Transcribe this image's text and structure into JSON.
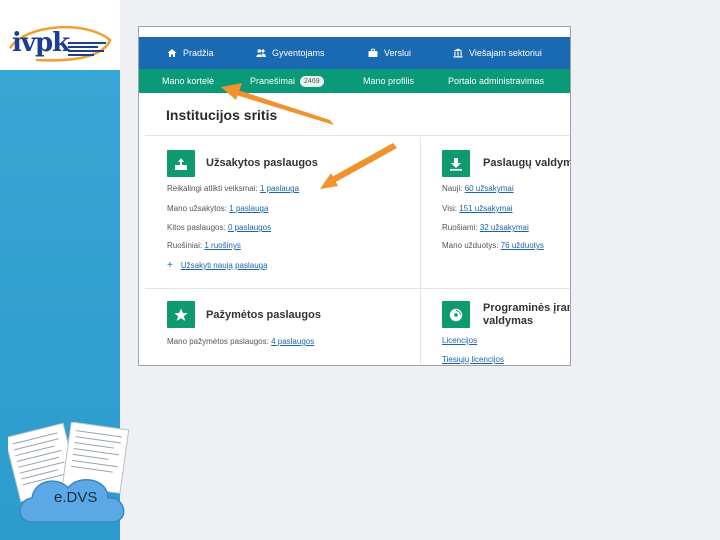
{
  "logo": {
    "text": "ivpk"
  },
  "cloud": {
    "label": "e.DVS"
  },
  "topnav": {
    "items": [
      {
        "icon": "home-icon",
        "label": "Pradžia"
      },
      {
        "icon": "people-icon",
        "label": "Gyventojams"
      },
      {
        "icon": "briefcase-icon",
        "label": "Verslui"
      },
      {
        "icon": "institution-icon",
        "label": "Viešajam sektoriui"
      }
    ]
  },
  "subnav": {
    "items": [
      {
        "label": "Mano kortelė"
      },
      {
        "label": "Pranešimai",
        "badge": "2469"
      },
      {
        "label": "Mano profilis"
      },
      {
        "label": "Portalo administravimas"
      }
    ]
  },
  "page": {
    "title": "Institucijos sritis"
  },
  "cards": {
    "ordered": {
      "title": "Užsakytos paslaugos",
      "rows": [
        {
          "label": "Reikalingi atlikti veiksmai:",
          "link": "1 paslauga"
        },
        {
          "label": "Mano užsakytos:",
          "link": "1 paslauga"
        },
        {
          "label": "Kitos paslaugos:",
          "link": "0 paslaugos"
        },
        {
          "label": "Ruošiniai:",
          "link": "1 ruošinys"
        }
      ],
      "add_label": "Užsakyti naują paslaugą"
    },
    "management": {
      "title": "Paslaugų valdymas",
      "rows": [
        {
          "label": "Nauji:",
          "link": "60 užsakymai"
        },
        {
          "label": "Visi:",
          "link": "151 užsakymai"
        },
        {
          "label": "Ruošiami:",
          "link": "32 užsakymai"
        },
        {
          "label": "Mano užduotys:",
          "link": "76 užduotys"
        }
      ]
    },
    "marked": {
      "title": "Pažymėtos paslaugos",
      "rows": [
        {
          "label": "Mano pažymėtos paslaugos:",
          "link": "4 paslaugos"
        }
      ]
    },
    "software": {
      "title_line1": "Programinės įrangos",
      "title_line2": "valdymas",
      "links": [
        "Licencijos",
        "Tiesiųjų licencijos"
      ]
    }
  },
  "colors": {
    "topnav": "#1a69b3",
    "subnav": "#0b9a78",
    "card_icon": "#0e9a6e",
    "link": "#1a63ad",
    "side_band": "#2b9ccc",
    "arrow": "#f0922e"
  }
}
